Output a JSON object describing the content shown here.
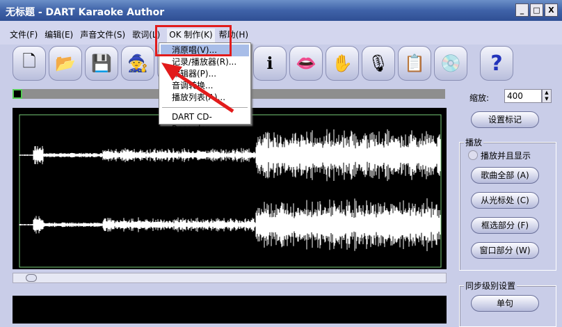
{
  "window": {
    "title": "无标题 - DART Karaoke Author",
    "buttons": [
      "_",
      "□",
      "X"
    ]
  },
  "menu": [
    "文件(F)",
    "编辑(E)",
    "声音文件(S)",
    "歌词(L)",
    "OK 制作(K)",
    "帮助(H)"
  ],
  "dropdown": {
    "items": [
      "消原唱(V)...",
      "记录/播放器(R)...",
      "编辑器(P)...",
      "音调转换...",
      "播放列表(A)...",
      "DART CD-Recorder"
    ]
  },
  "toolbar": [
    {
      "name": "new-file-icon",
      "glyph": "🗋"
    },
    {
      "name": "open-folder-icon",
      "glyph": "📂"
    },
    {
      "name": "save-icon",
      "glyph": "💾"
    },
    {
      "name": "wizard-icon",
      "glyph": "🧙"
    },
    {
      "name": "hidden-icon",
      "glyph": ""
    },
    {
      "name": "info-icon",
      "glyph": "ℹ"
    },
    {
      "name": "no-singing-icon",
      "glyph": "👄"
    },
    {
      "name": "hand-tool-icon",
      "glyph": "✋"
    },
    {
      "name": "on-air-mic-icon",
      "glyph": "🎙"
    },
    {
      "name": "clipboard-icon",
      "glyph": "📋"
    },
    {
      "name": "cd-icon",
      "glyph": "💿"
    },
    {
      "name": "help-icon",
      "glyph": "?"
    }
  ],
  "right": {
    "zoom_label": "缩放:",
    "zoom_value": "400",
    "set_marker": "设置标记",
    "play_group": "播放",
    "play_and_show": "播放并且显示",
    "song_all": "歌曲全部 (A)",
    "from_cursor": "从光标处 (C)",
    "selection": "框选部分 (F)",
    "window_part": "窗口部分 (W)",
    "sync_group": "同步级别设置",
    "single_line": "单句"
  }
}
